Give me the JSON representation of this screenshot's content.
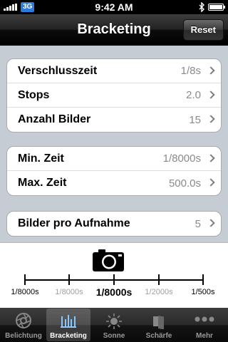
{
  "status": {
    "network": "3G",
    "time": "9:42 AM"
  },
  "navbar": {
    "title": "Bracketing",
    "reset_label": "Reset"
  },
  "groups": [
    {
      "rows": [
        {
          "label": "Verschlusszeit",
          "value": "1/8s"
        },
        {
          "label": "Stops",
          "value": "2.0"
        },
        {
          "label": "Anzahl Bilder",
          "value": "15"
        }
      ]
    },
    {
      "rows": [
        {
          "label": "Min. Zeit",
          "value": "1/8000s"
        },
        {
          "label": "Max. Zeit",
          "value": "500.0s"
        }
      ]
    },
    {
      "rows": [
        {
          "label": "Bilder pro Aufnahme",
          "value": "5"
        }
      ]
    }
  ],
  "scale": {
    "ticks": [
      "1/8000s",
      "1/8000s",
      "1/8000s",
      "1/2000s",
      "1/500s"
    ]
  },
  "tabs": [
    {
      "label": "Belichtung",
      "icon": "aperture-icon"
    },
    {
      "label": "Bracketing",
      "icon": "bracketing-icon"
    },
    {
      "label": "Sonne",
      "icon": "sun-icon"
    },
    {
      "label": "Schärfe",
      "icon": "sharpness-icon"
    },
    {
      "label": "Mehr",
      "icon": "more-icon"
    }
  ],
  "colors": {
    "background": "#c5ccd4",
    "network_badge": "#2c7be0",
    "value_text": "#8a8a8a",
    "muted_tick": "#a0a0a0"
  }
}
